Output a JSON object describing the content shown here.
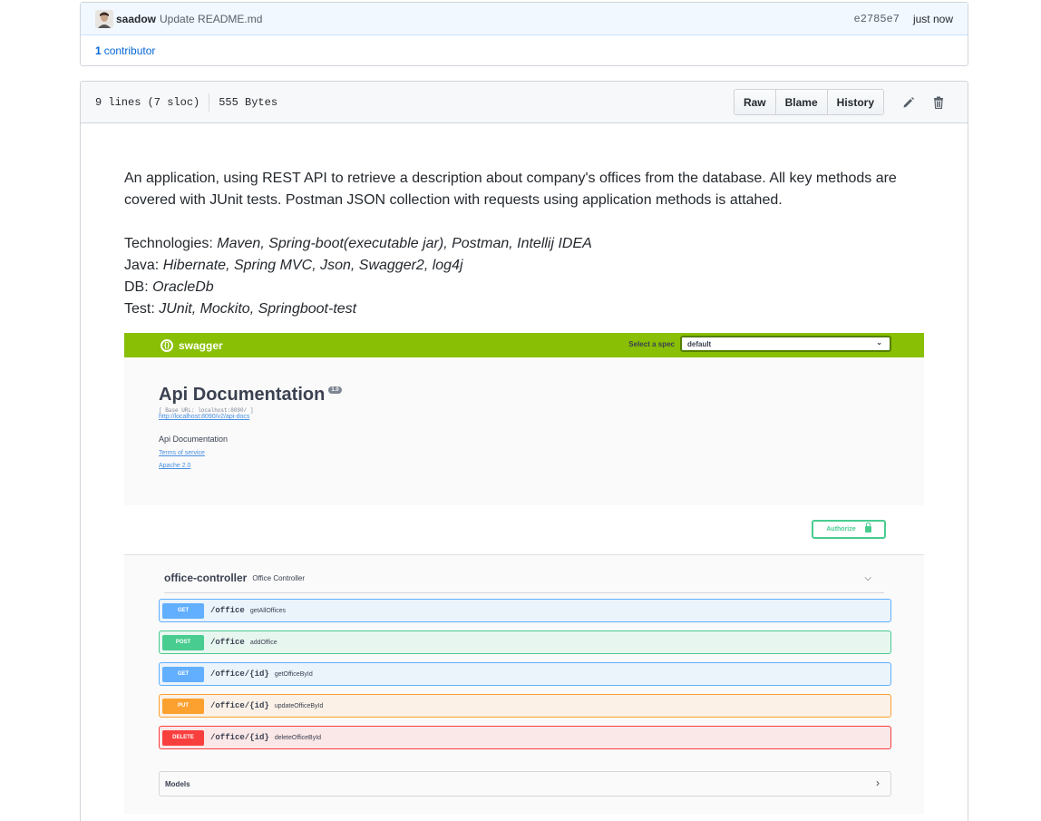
{
  "commit": {
    "author": "saadow",
    "message": "Update README.md",
    "sha": "e2785e7",
    "time": "just now",
    "contributors_count": "1",
    "contributors_label": "contributor"
  },
  "file": {
    "lines_info": "9 lines (7 sloc)",
    "size": "555 Bytes",
    "buttons": {
      "raw": "Raw",
      "blame": "Blame",
      "history": "History"
    },
    "icons": {
      "edit": "pencil-icon",
      "delete": "trash-icon"
    }
  },
  "readme": {
    "intro": "An application, using REST API to retrieve a description about company's offices from the database. All key methods are covered with JUnit tests. Postman JSON collection with requests using application methods is attahed.",
    "lines": [
      {
        "label": "Technologies: ",
        "value": "Maven, Spring-boot(executable jar), Postman, Intellij IDEA"
      },
      {
        "label": "Java: ",
        "value": "Hibernate, Spring MVC, Json, Swagger2, log4j"
      },
      {
        "label": "DB: ",
        "value": "OracleDb"
      },
      {
        "label": "Test: ",
        "value": "JUnit, Mockito, Springboot-test"
      }
    ]
  },
  "swagger": {
    "logo_text": "swagger",
    "spec_label": "Select a spec",
    "spec_value": "default",
    "title": "Api Documentation",
    "version": "1.0",
    "base_url": "[ Base URL: localhost:8090/ ]",
    "api_docs_link": "http://localhost:8090/v2/api-docs",
    "description": "Api Documentation",
    "terms": "Terms of service",
    "license": "Apache 2.0",
    "authorize": "Authorize",
    "tag_name": "office-controller",
    "tag_desc": "Office Controller",
    "operations": [
      {
        "method": "GET",
        "path": "/office",
        "summary": "getAllOffices"
      },
      {
        "method": "POST",
        "path": "/office",
        "summary": "addOffice"
      },
      {
        "method": "GET",
        "path": "/office/{id}",
        "summary": "getOfficeById"
      },
      {
        "method": "PUT",
        "path": "/office/{id}",
        "summary": "updateOfficeById"
      },
      {
        "method": "DELETE",
        "path": "/office/{id}",
        "summary": "deleteOfficeById"
      }
    ],
    "models": "Models",
    "colors": {
      "topbar": "#89bf04",
      "get": "#61affe",
      "post": "#49cc90",
      "put": "#fca130",
      "delete": "#f93e3e"
    }
  }
}
